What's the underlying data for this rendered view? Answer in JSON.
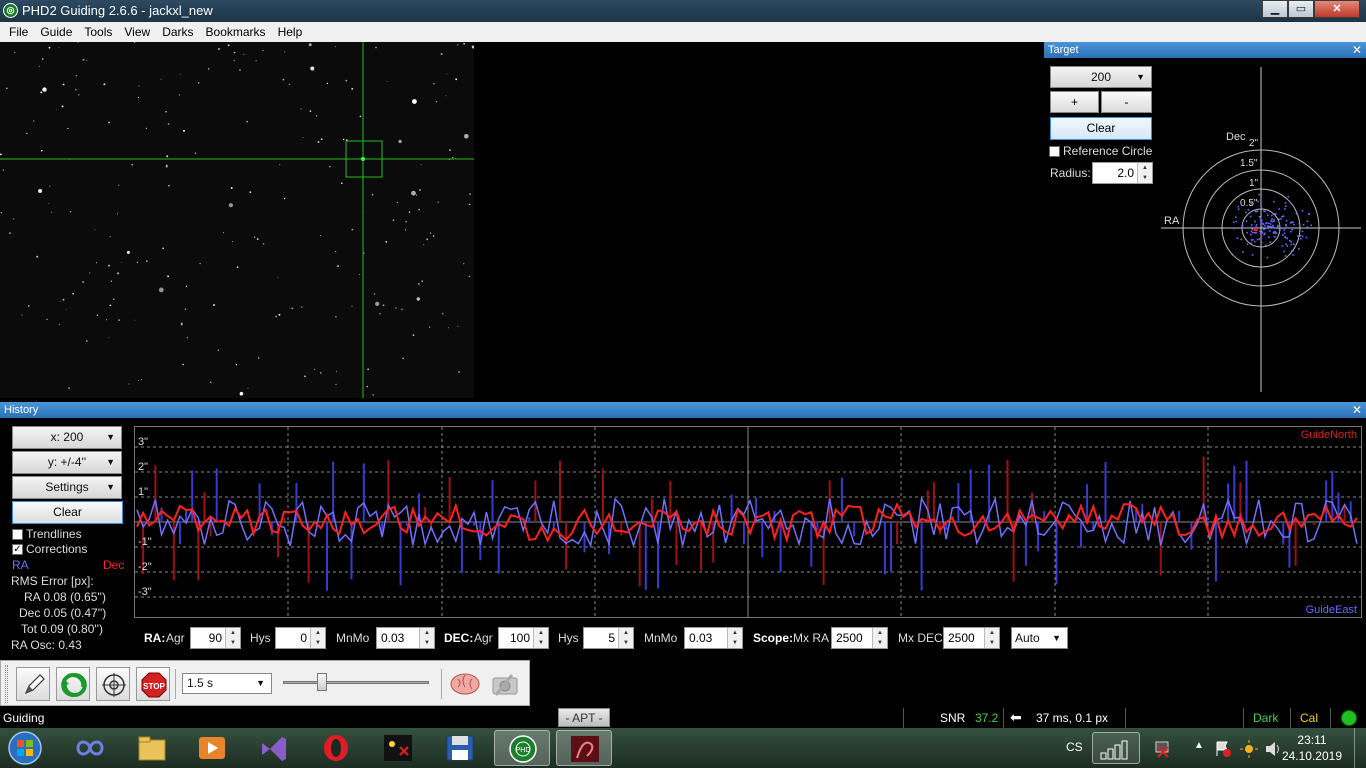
{
  "window": {
    "title": "PHD2 Guiding 2.6.6 - jackxl_new",
    "icon": "phd-app-icon",
    "controls": [
      "minimize-icon",
      "maximize-icon",
      "close-icon"
    ]
  },
  "menu": [
    "File",
    "Guide",
    "Tools",
    "View",
    "Darks",
    "Bookmarks",
    "Help"
  ],
  "target": {
    "pane_title": "Target",
    "length_value": "200",
    "plus_label": "+",
    "minus_label": "-",
    "clear_label": "Clear",
    "reference_circle_label": "Reference Circle",
    "reference_circle_checked": false,
    "radius_label": "Radius:",
    "radius_value": "2.0",
    "axis_dec": "Dec",
    "axis_ra": "RA",
    "ring_labels": [
      "2\"",
      "1.5\"",
      "1\"",
      "0.5\""
    ]
  },
  "history": {
    "pane_title": "History",
    "x_scale": "x: 200",
    "y_scale": "y: +/-4''",
    "settings_label": "Settings",
    "clear_label": "Clear",
    "trendlines_label": "Trendlines",
    "trendlines_checked": false,
    "corrections_label": "Corrections",
    "corrections_checked": true,
    "ra_legend": "RA",
    "dec_legend": "Dec",
    "rms_title": "RMS Error [px]:",
    "rms_ra": "RA 0.08 (0.65'')",
    "rms_dec": "Dec 0.05 (0.47'')",
    "rms_tot": "Tot 0.09 (0.80'')",
    "ra_osc": "RA Osc: 0.43",
    "y_ticks": [
      "3\"",
      "2\"",
      "1\"",
      "-1\"",
      "-2\"",
      "-3\""
    ],
    "guide_north": "GuideNorth",
    "guide_east": "GuideEast",
    "colors": {
      "ra": "#7070ff",
      "dec": "#ff2020",
      "ra_corr": "#3a3ad0",
      "dec_corr": "#a01010"
    }
  },
  "params": {
    "ra_label": "RA:",
    "agr_label": "Agr",
    "ra_agr": "90",
    "hys_label": "Hys",
    "ra_hys": "0",
    "mnmo_label": "MnMo",
    "ra_mnmo": "0.03",
    "dec_label": "DEC:",
    "dec_agr": "100",
    "dec_hys": "5",
    "dec_mnmo": "0.03",
    "scope_label": "Scope:",
    "mxra_label": "Mx RA",
    "mx_ra": "2500",
    "mxdec_label": "Mx DEC",
    "mx_dec": "2500",
    "dec_mode": "Auto"
  },
  "toolbar": {
    "exposure": "1.5 s",
    "exposure_fraction": 0.23,
    "icons": [
      "pencil-icon",
      "loop-icon",
      "crosshair-icon",
      "stop-icon",
      "brain-icon",
      "camera-settings-icon"
    ]
  },
  "status": {
    "state": "Guiding",
    "apt": "- APT -",
    "snr_label": "SNR",
    "snr_value": "37.2",
    "pulse": "37 ms, 0.1 px",
    "dark": "Dark",
    "cal": "Cal"
  },
  "taskbar": {
    "lang": "CS",
    "time": "23:11",
    "date": "24.10.2019",
    "apps": [
      "windows-start-icon",
      "infinity-app-icon",
      "file-explorer-icon",
      "media-player-icon",
      "visual-studio-icon",
      "opera-icon",
      "guidemaster-icon",
      "save-disk-icon",
      "phd-taskbar-icon",
      "apt-taskbar-icon"
    ]
  }
}
